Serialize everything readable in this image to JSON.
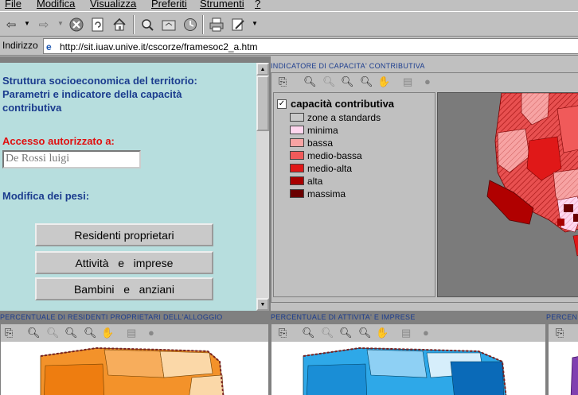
{
  "menu": [
    "File",
    "Modifica",
    "Visualizza",
    "Preferiti",
    "Strumenti",
    "?"
  ],
  "address": {
    "label": "Indirizzo",
    "url": "http://sit.iuav.unive.it/cscorze/framesoc2_a.htm"
  },
  "left": {
    "title": "Struttura socioeconomica del territorio: Parametri e indicatore della capacità contributiva",
    "access_label": "Accesso autorizzato a:",
    "user_value": "De Rossi luigi",
    "weights_label": "Modifica dei pesi:",
    "buttons": [
      "Residenti proprietari",
      "Attività   e   imprese",
      "Bambini   e   anziani"
    ]
  },
  "main_panel": {
    "title": "INDICATORE DI CAPACITA' CONTRIBUTIVA",
    "legend_title": "capacità contributiva",
    "legend": [
      {
        "label": "zone a standards",
        "color": "#c8c8c8"
      },
      {
        "label": "minima",
        "color": "#ffd6ee"
      },
      {
        "label": "bassa",
        "color": "#f7a3a3"
      },
      {
        "label": "medio-bassa",
        "color": "#f05a5a"
      },
      {
        "label": "medio-alta",
        "color": "#e01818"
      },
      {
        "label": "alta",
        "color": "#a80000"
      },
      {
        "label": "massima",
        "color": "#6a0000"
      }
    ]
  },
  "bottom_panels": [
    {
      "title": "PERCENTUALE DI RESIDENTI PROPRIETARI DELL'ALLOGGIO",
      "accent": "#f3922a"
    },
    {
      "title": "PERCENTUALE DI ATTIVITA' E IMPRESE",
      "accent": "#2ea8e8"
    },
    {
      "title": "PERCEN",
      "accent": "#8040b0"
    }
  ],
  "icons": {
    "map_tools": [
      "copy-icon",
      "zoom-in-icon",
      "zoom-in-disabled-icon",
      "zoom-out-icon",
      "zoom-reset-icon",
      "pan-hand-icon",
      "document-icon",
      "stop-icon"
    ]
  }
}
